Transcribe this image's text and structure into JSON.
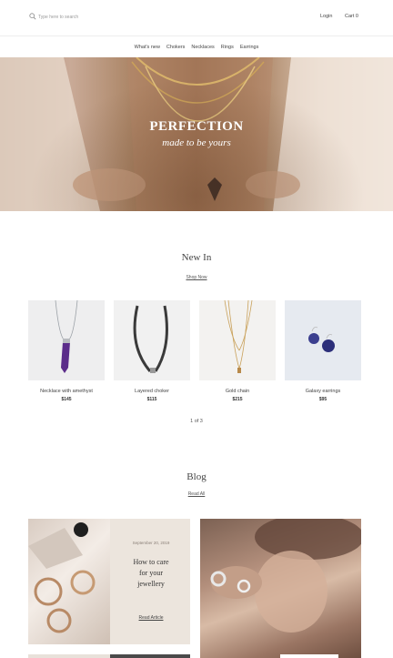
{
  "header": {
    "search_placeholder": "Type here to search",
    "login_label": "Login",
    "cart_label": "Cart 0"
  },
  "nav": {
    "items": [
      "What's new",
      "Chokers",
      "Necklaces",
      "Rings",
      "Earrings"
    ]
  },
  "hero": {
    "title": "PERFECTION",
    "subtitle": "made to be yours"
  },
  "new_in": {
    "title": "New In",
    "link_label": "Shop Now",
    "products": [
      {
        "name": "Necklace with amethyst",
        "price": "$145",
        "icon": "amethyst-necklace-photo"
      },
      {
        "name": "Layered choker",
        "price": "$115",
        "icon": "choker-photo"
      },
      {
        "name": "Gold chain",
        "price": "$215",
        "icon": "gold-chain-photo"
      },
      {
        "name": "Galaxy earrings",
        "price": "$95",
        "icon": "galaxy-earrings-photo"
      }
    ],
    "pager": "1 of 3"
  },
  "blog": {
    "title": "Blog",
    "link_label": "Read All",
    "posts": [
      {
        "date": "September 20, 2019",
        "title": "How to care for your jewellery",
        "link_label": "Read Article"
      }
    ]
  },
  "colors": {
    "accent_text": "#444444",
    "hero_tone": "#a7805f",
    "blog_card_bg": "#ece5dd"
  }
}
